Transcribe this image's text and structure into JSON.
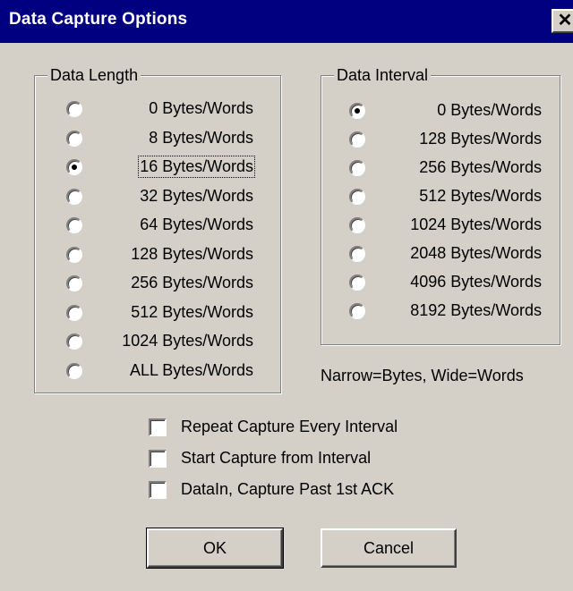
{
  "window": {
    "title": "Data Capture Options",
    "close_glyph": "✕",
    "background_color": "#d4d0c8",
    "titlebar_color": "#000080"
  },
  "data_length": {
    "legend": "Data Length",
    "options": [
      {
        "label": "0 Bytes/Words",
        "checked": false
      },
      {
        "label": "8 Bytes/Words",
        "checked": false
      },
      {
        "label": "16 Bytes/Words",
        "checked": true
      },
      {
        "label": "32 Bytes/Words",
        "checked": false
      },
      {
        "label": "64 Bytes/Words",
        "checked": false
      },
      {
        "label": "128 Bytes/Words",
        "checked": false
      },
      {
        "label": "256 Bytes/Words",
        "checked": false
      },
      {
        "label": "512 Bytes/Words",
        "checked": false
      },
      {
        "label": "1024 Bytes/Words",
        "checked": false
      },
      {
        "label": "ALL Bytes/Words",
        "checked": false
      }
    ]
  },
  "data_interval": {
    "legend": "Data Interval",
    "options": [
      {
        "label": "0 Bytes/Words",
        "checked": true
      },
      {
        "label": "128 Bytes/Words",
        "checked": false
      },
      {
        "label": "256 Bytes/Words",
        "checked": false
      },
      {
        "label": "512 Bytes/Words",
        "checked": false
      },
      {
        "label": "1024 Bytes/Words",
        "checked": false
      },
      {
        "label": "2048 Bytes/Words",
        "checked": false
      },
      {
        "label": "4096 Bytes/Words",
        "checked": false
      },
      {
        "label": "8192 Bytes/Words",
        "checked": false
      }
    ]
  },
  "note": "Narrow=Bytes, Wide=Words",
  "checkboxes": [
    {
      "label": "Repeat Capture Every Interval",
      "checked": false
    },
    {
      "label": "Start Capture from Interval",
      "checked": false
    },
    {
      "label": "DataIn, Capture Past 1st ACK",
      "checked": false
    }
  ],
  "buttons": {
    "ok_label": "OK",
    "cancel_label": "Cancel"
  }
}
